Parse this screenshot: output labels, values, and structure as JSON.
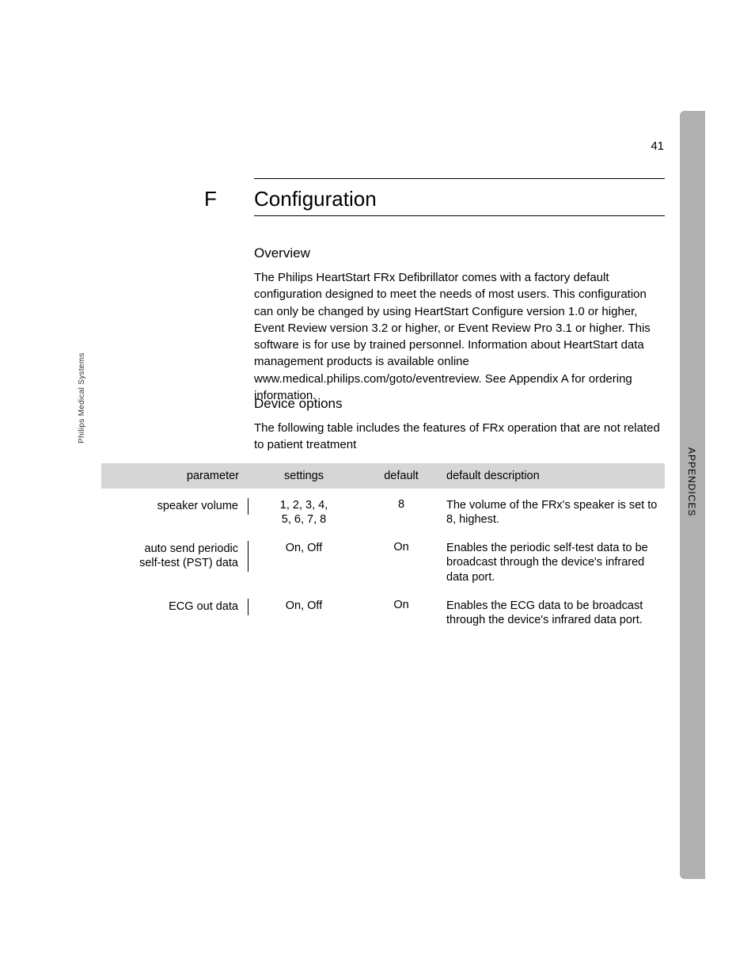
{
  "page_number": "41",
  "side_label": "Philips Medical Systems",
  "tab_label": "APPENDICES",
  "appendix_letter": "F",
  "chapter_title": "Configuration",
  "section1": {
    "heading": "Overview",
    "body": "The Philips HeartStart FRx Defibrillator comes with a factory default configuration designed to meet the needs of most users. This configuration can only be changed by using HeartStart Configure version 1.0 or higher, Event Review version 3.2 or higher, or Event Review Pro 3.1 or higher. This software is for use by trained personnel. Information about HeartStart data management products is available online www.medical.philips.com/goto/eventreview. See Appendix A for ordering information."
  },
  "section2": {
    "heading": "Device options",
    "body": "The following table includes the features of FRx operation that are not related to patient treatment"
  },
  "table": {
    "headers": {
      "parameter": "parameter",
      "settings": "settings",
      "default": "default",
      "description": "default description"
    },
    "rows": [
      {
        "parameter": "speaker volume",
        "settings": "1, 2, 3, 4,\n5, 6, 7, 8",
        "default": "8",
        "description": "The volume of the FRx's speaker is set to 8, highest."
      },
      {
        "parameter": "auto send periodic\nself-test (PST) data",
        "settings": "On, Off",
        "default": "On",
        "description": "Enables the periodic self-test data to be broadcast through the device's infrared data port."
      },
      {
        "parameter": "ECG out data",
        "settings": "On, Off",
        "default": "On",
        "description": "Enables the ECG data to be broadcast through the device's infrared data port."
      }
    ]
  }
}
